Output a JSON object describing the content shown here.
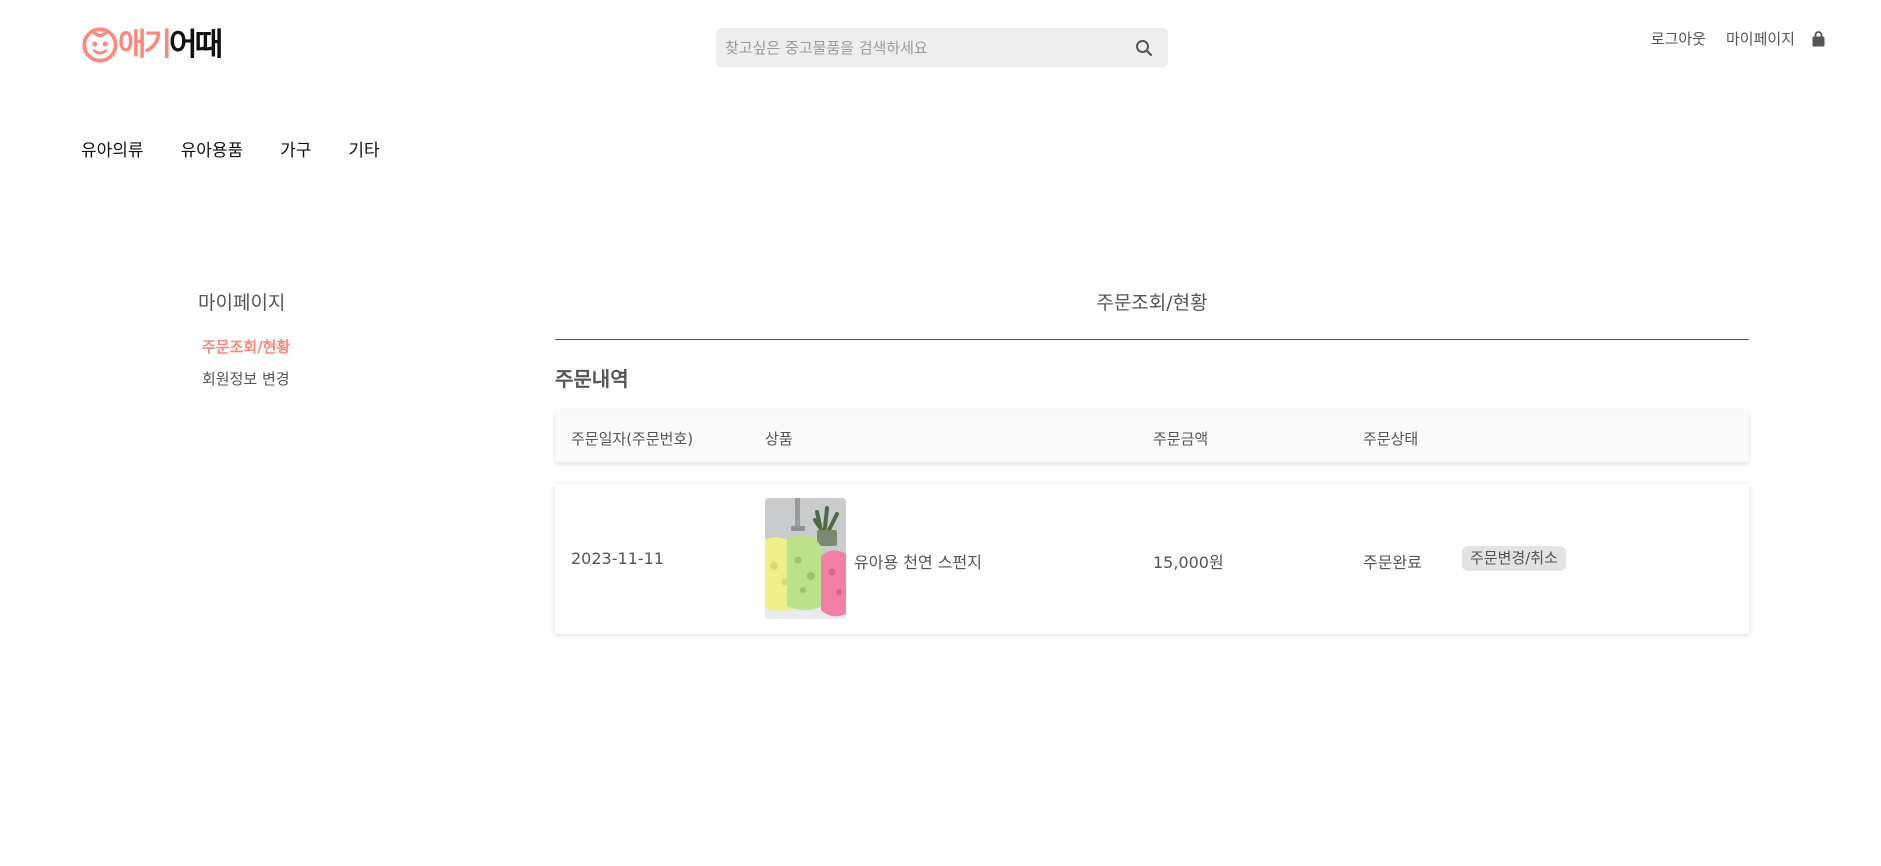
{
  "header": {
    "logo": {
      "accent_text": "애기",
      "dark_text": "어때",
      "accent_color": "#fa8a7e"
    },
    "search": {
      "placeholder": "찾고싶은 중고물품을 검색하세요",
      "value": "",
      "icon": "search-icon"
    },
    "links": {
      "logout": "로그아웃",
      "mypage": "마이페이지",
      "cart_icon": "shopping-bag-icon"
    }
  },
  "categories": [
    "유아의류",
    "유아용품",
    "가구",
    "기타"
  ],
  "sidebar": {
    "title": "마이페이지",
    "items": [
      {
        "label": "주문조회/현황",
        "active": true
      },
      {
        "label": "회원정보 변경",
        "active": false
      }
    ]
  },
  "main": {
    "title": "주문조회/현황",
    "section_title": "주문내역",
    "table": {
      "headers": [
        "주문일자(주문번호)",
        "상품",
        "주문금액",
        "주문상태"
      ],
      "rows": [
        {
          "date": "2023-11-11",
          "product_name": "유아용 천연 스펀지",
          "amount": "15,000원",
          "status": "주문완료",
          "action": "주문변경/취소"
        }
      ]
    }
  },
  "colors": {
    "accent": "#fa8a7e",
    "text": "#555555",
    "search_bg": "#eeeeee"
  }
}
